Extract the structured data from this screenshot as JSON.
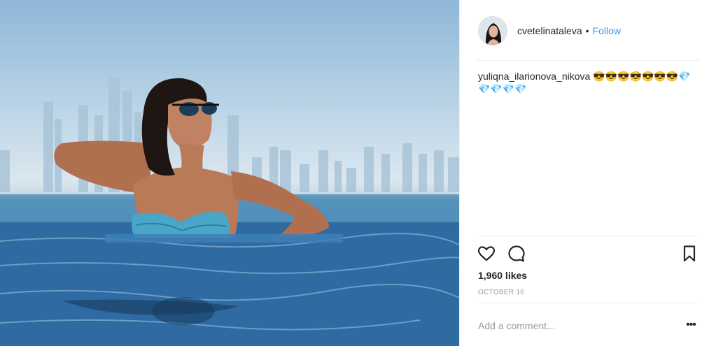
{
  "post": {
    "username": "cvetelinataleva",
    "separator": "•",
    "follow_label": "Follow",
    "caption": {
      "author": "yuliqna_ilarionova_nikova",
      "text": "😎😎😎😎😎😎😎💎💎💎💎💎"
    },
    "likes": "1,960 likes",
    "date": "OCTOBER 16",
    "comment_placeholder": "Add a comment...",
    "more_label": "•••"
  },
  "icons": {
    "like": "heart-outline-icon",
    "comment": "speech-bubble-icon",
    "save": "bookmark-icon",
    "more": "ellipsis-icon"
  },
  "colors": {
    "follow": "#3897f0",
    "text": "#262626",
    "muted": "#999999",
    "divider": "#efefef"
  }
}
